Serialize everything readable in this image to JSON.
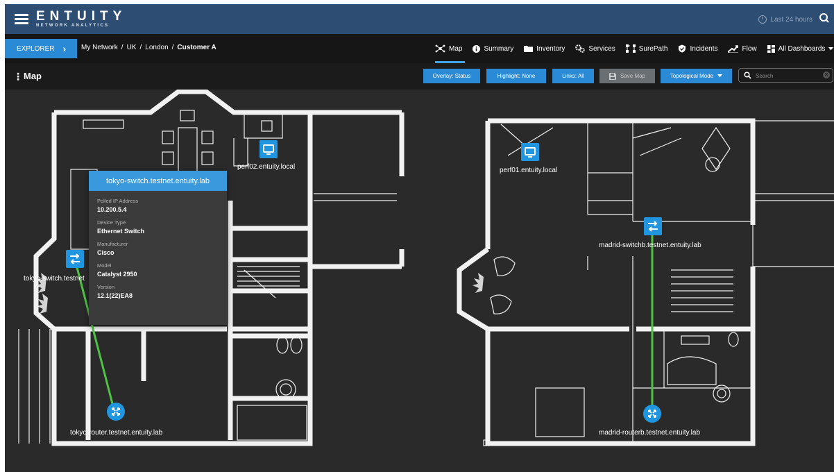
{
  "app": {
    "logo_main": "ENTUITY",
    "logo_sub": "NETWORK ANALYTICS",
    "time_range": "Last 24 hours"
  },
  "nav": {
    "explorer_label": "EXPLORER",
    "breadcrumb": [
      "My Network",
      "UK",
      "London",
      "Customer A"
    ],
    "tabs": [
      {
        "label": "Map",
        "icon": "map-network-icon",
        "active": true
      },
      {
        "label": "Summary",
        "icon": "info-icon"
      },
      {
        "label": "Inventory",
        "icon": "folder-icon"
      },
      {
        "label": "Services",
        "icon": "services-icon"
      },
      {
        "label": "SurePath",
        "icon": "surepath-icon"
      },
      {
        "label": "Incidents",
        "icon": "shield-icon"
      },
      {
        "label": "Flow",
        "icon": "flow-icon"
      },
      {
        "label": "All Dashboards",
        "icon": "dashboard-icon"
      }
    ]
  },
  "toolbar": {
    "title": "Map",
    "overlay": "Overlay: Status",
    "highlight": "Highlight: None",
    "links": "Links: All",
    "save": "Save Map",
    "mode": "Topological Mode",
    "search_placeholder": "Search"
  },
  "devices": {
    "tokyo_switch": "tokyo-switch.testnet",
    "tokyo_router": "tokyo-router.testnet.entuity.lab",
    "perf02": "perf02.entuity.local",
    "perf01": "perf01.entuity.local",
    "madrid_switch": "madrid-switchb.testnet.entuity.lab",
    "madrid_router": "madrid-routerb.testnet.entuity.lab"
  },
  "tooltip": {
    "title": "tokyo-switch.testnet.entuity.lab",
    "fields": [
      {
        "label": "Polled IP Address",
        "value": "10.200.5.4"
      },
      {
        "label": "Device Type",
        "value": "Ethernet Switch"
      },
      {
        "label": "Manufacturer",
        "value": "Cisco"
      },
      {
        "label": "Model",
        "value": "Catalyst 2950"
      },
      {
        "label": "Version",
        "value": "12.1(22)EA8"
      }
    ]
  },
  "colors": {
    "header": "#2d4e72",
    "accent": "#2a8ad6",
    "link": "#4fc244",
    "device": "#2196e0"
  }
}
